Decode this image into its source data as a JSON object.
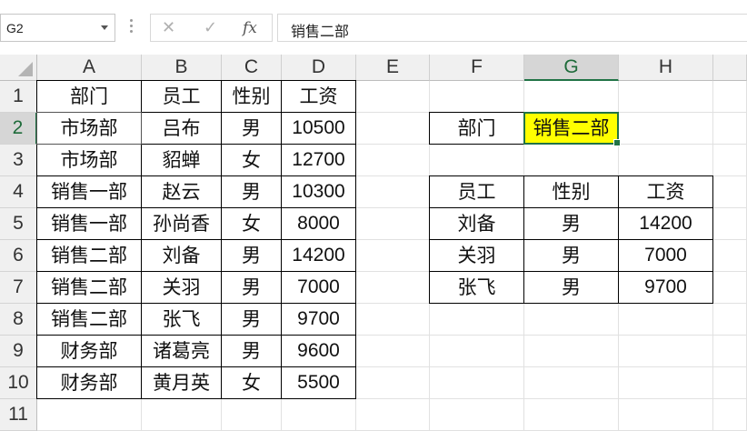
{
  "formula_bar": {
    "name_box": "G2",
    "cancel_icon": "✕",
    "enter_icon": "✓",
    "fx_label": "fx",
    "formula": "销售二部"
  },
  "columns": [
    "A",
    "B",
    "C",
    "D",
    "E",
    "F",
    "G",
    "H"
  ],
  "rows": [
    "1",
    "2",
    "3",
    "4",
    "5",
    "6",
    "7",
    "8",
    "9",
    "10",
    "11"
  ],
  "active_cell": "G2",
  "colors": {
    "highlight": "#ffff00",
    "selection": "#217346"
  },
  "cells": {
    "A1": "部门",
    "B1": "员工",
    "C1": "性别",
    "D1": "工资",
    "A2": "市场部",
    "B2": "吕布",
    "C2": "男",
    "D2": "10500",
    "A3": "市场部",
    "B3": "貂蝉",
    "C3": "女",
    "D3": "12700",
    "A4": "销售一部",
    "B4": "赵云",
    "C4": "男",
    "D4": "10300",
    "A5": "销售一部",
    "B5": "孙尚香",
    "C5": "女",
    "D5": "8000",
    "A6": "销售二部",
    "B6": "刘备",
    "C6": "男",
    "D6": "14200",
    "A7": "销售二部",
    "B7": "关羽",
    "C7": "男",
    "D7": "7000",
    "A8": "销售二部",
    "B8": "张飞",
    "C8": "男",
    "D8": "9700",
    "A9": "财务部",
    "B9": "诸葛亮",
    "C9": "男",
    "D9": "9600",
    "A10": "财务部",
    "B10": "黄月英",
    "C10": "女",
    "D10": "5500",
    "F2": "部门",
    "G2": "销售二部",
    "F4": "员工",
    "G4": "性别",
    "H4": "工资",
    "F5": "刘备",
    "G5": "男",
    "H5": "14200",
    "F6": "关羽",
    "G6": "男",
    "H6": "7000",
    "F7": "张飞",
    "G7": "男",
    "H7": "9700"
  }
}
